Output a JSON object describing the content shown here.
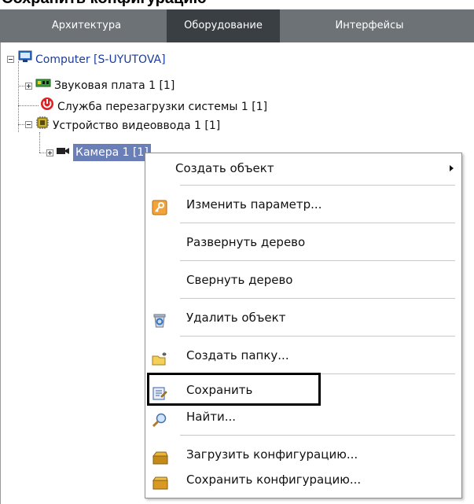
{
  "tabs": [
    {
      "label": "Архитектура",
      "active": false
    },
    {
      "label": "Оборудование",
      "active": true
    },
    {
      "label": "Интерфейсы",
      "active": false
    }
  ],
  "tree": {
    "root": "Computer [S-UYUTOVA]",
    "sound": "Звуковая плата 1 [1]",
    "reboot": "Служба перезагрузки системы 1 [1]",
    "video": "Устройство видеоввода 1 [1]",
    "camera": "Камера 1 [1]"
  },
  "menu": {
    "create_object": "Создать объект",
    "edit_param": "Изменить параметр...",
    "expand_tree": "Развернуть дерево",
    "collapse_tree": "Свернуть дерево",
    "delete_object": "Удалить объект",
    "create_folder": "Создать папку...",
    "save": "Сохранить",
    "find": "Найти...",
    "load_config": "Загрузить конфигурацию...",
    "save_config": "Сохранить конфигурацию..."
  },
  "colors": {
    "tabbar": "#6d7276",
    "tab_active": "#3a3f44",
    "selection": "#6a7fb8",
    "highlight_box": "#000000"
  }
}
